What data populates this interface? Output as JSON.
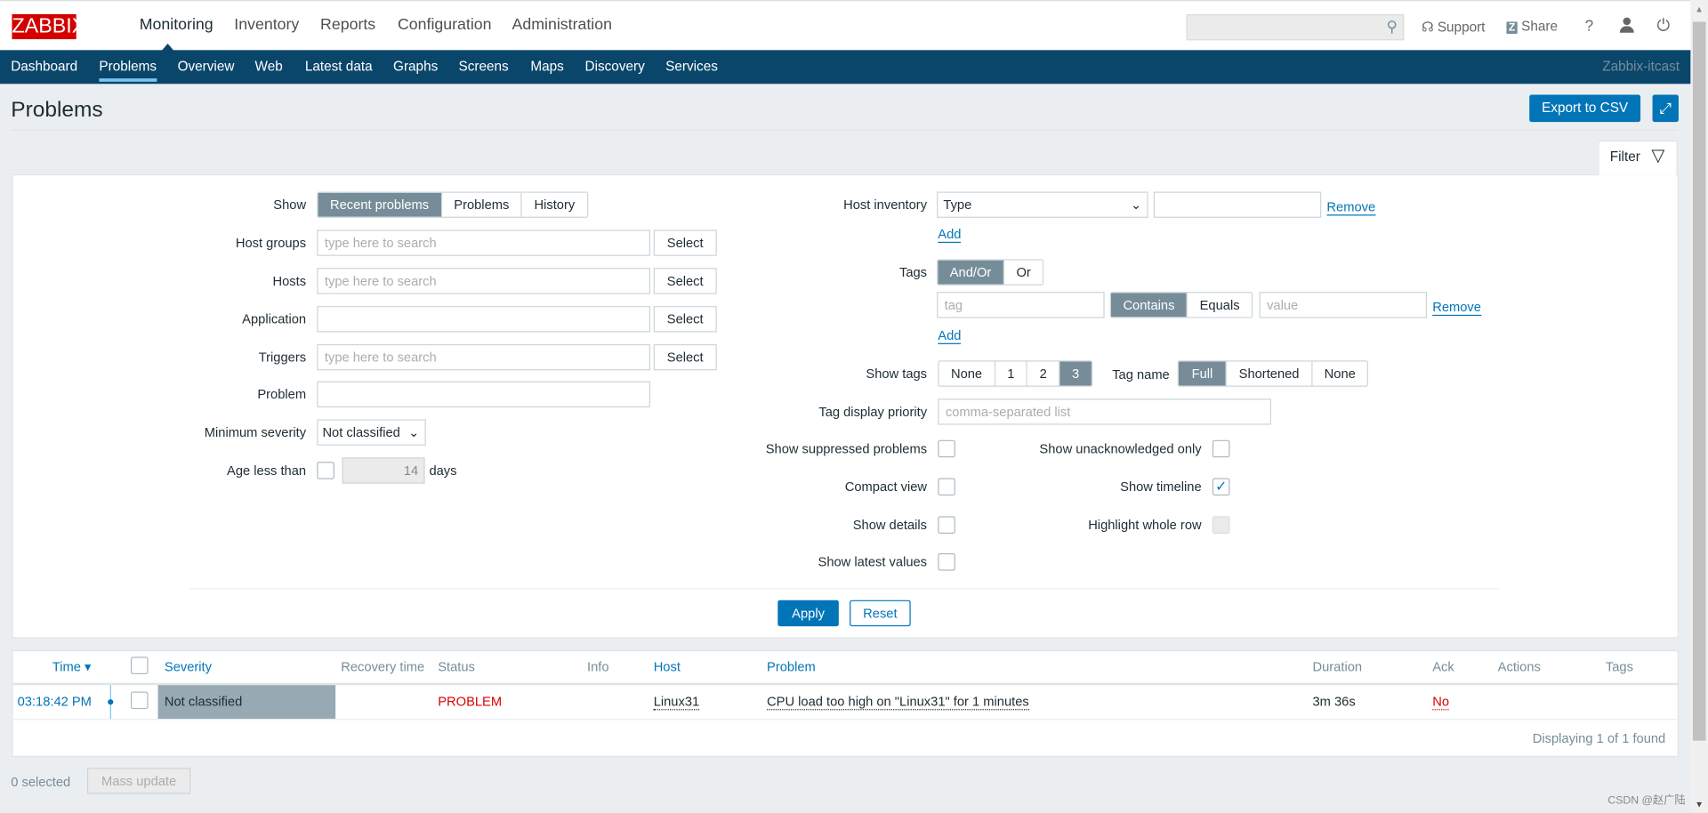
{
  "header": {
    "logo": "ZABBIX",
    "menu": [
      "Monitoring",
      "Inventory",
      "Reports",
      "Configuration",
      "Administration"
    ],
    "search_placeholder": "",
    "support": "Support",
    "share": "Share",
    "help": "?"
  },
  "nav": {
    "items": [
      "Dashboard",
      "Problems",
      "Overview",
      "Web",
      "Latest data",
      "Graphs",
      "Screens",
      "Maps",
      "Discovery",
      "Services"
    ],
    "active": "Problems",
    "server_name": "Zabbix-itcast"
  },
  "page": {
    "title": "Problems",
    "export": "Export to CSV",
    "filter_tab": "Filter"
  },
  "filter": {
    "show_label": "Show",
    "show_options": [
      "Recent problems",
      "Problems",
      "History"
    ],
    "host_groups_label": "Host groups",
    "hosts_label": "Hosts",
    "application_label": "Application",
    "triggers_label": "Triggers",
    "problem_label": "Problem",
    "search_placeholder": "type here to search",
    "select": "Select",
    "min_severity_label": "Minimum severity",
    "min_severity_value": "Not classified",
    "age_label": "Age less than",
    "age_value": "14",
    "age_unit": "days",
    "host_inventory_label": "Host inventory",
    "host_inventory_type": "Type",
    "remove": "Remove",
    "add": "Add",
    "tags_label": "Tags",
    "tags_ops": [
      "And/Or",
      "Or"
    ],
    "tag_placeholder": "tag",
    "tag_ops": [
      "Contains",
      "Equals"
    ],
    "value_placeholder": "value",
    "show_tags_label": "Show tags",
    "show_tags_options": [
      "None",
      "1",
      "2",
      "3"
    ],
    "tag_name_label": "Tag name",
    "tag_name_options": [
      "Full",
      "Shortened",
      "None"
    ],
    "tag_priority_label": "Tag display priority",
    "tag_priority_placeholder": "comma-separated list",
    "show_suppressed": "Show suppressed problems",
    "compact_view": "Compact view",
    "show_details": "Show details",
    "show_latest": "Show latest values",
    "show_unack": "Show unacknowledged only",
    "show_timeline": "Show timeline",
    "show_timeline_checked": true,
    "highlight_row": "Highlight whole row",
    "apply": "Apply",
    "reset": "Reset"
  },
  "table": {
    "columns": [
      "Time ▾",
      "Severity",
      "Recovery time",
      "Status",
      "Info",
      "Host",
      "Problem",
      "Duration",
      "Ack",
      "Actions",
      "Tags"
    ],
    "rows": [
      {
        "time": "03:18:42 PM",
        "severity": "Not classified",
        "recovery_time": "",
        "status": "PROBLEM",
        "info": "",
        "host": "Linux31",
        "problem": "CPU load too high on \"Linux31\" for 1 minutes",
        "duration": "3m 36s",
        "ack": "No"
      }
    ],
    "footer": "Displaying 1 of 1 found"
  },
  "bottom": {
    "selected": "0 selected",
    "mass_update": "Mass update"
  },
  "watermark": "CSDN @赵广陆",
  "colors": {
    "nav": "#0a466a",
    "primary": "#0275b8",
    "problem": "#dc0000",
    "not_classified": "#97aab3"
  }
}
